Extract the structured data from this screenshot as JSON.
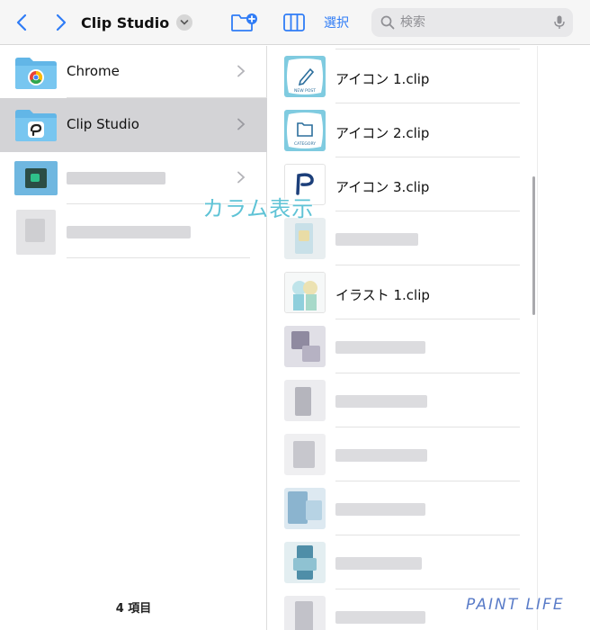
{
  "toolbar": {
    "title": "Clip Studio",
    "select_label": "選択",
    "search_placeholder": "検索"
  },
  "overlay_label": "カラム表示",
  "left_column": {
    "items": [
      {
        "label": "Chrome"
      },
      {
        "label": "Clip Studio"
      }
    ],
    "count": "4 項目"
  },
  "right_column": {
    "items": [
      {
        "label": "アイコン 1.clip"
      },
      {
        "label": "アイコン 2.clip"
      },
      {
        "label": "アイコン 3.clip"
      },
      {
        "label": "イラスト 1.clip"
      }
    ]
  },
  "watermark": "PAINT LIFE",
  "colors": {
    "accent": "#2f7cf6",
    "folder_blue": "#5fb8ea",
    "selected_row": "#d3d3d6",
    "overlay": "#5fc3d6"
  }
}
